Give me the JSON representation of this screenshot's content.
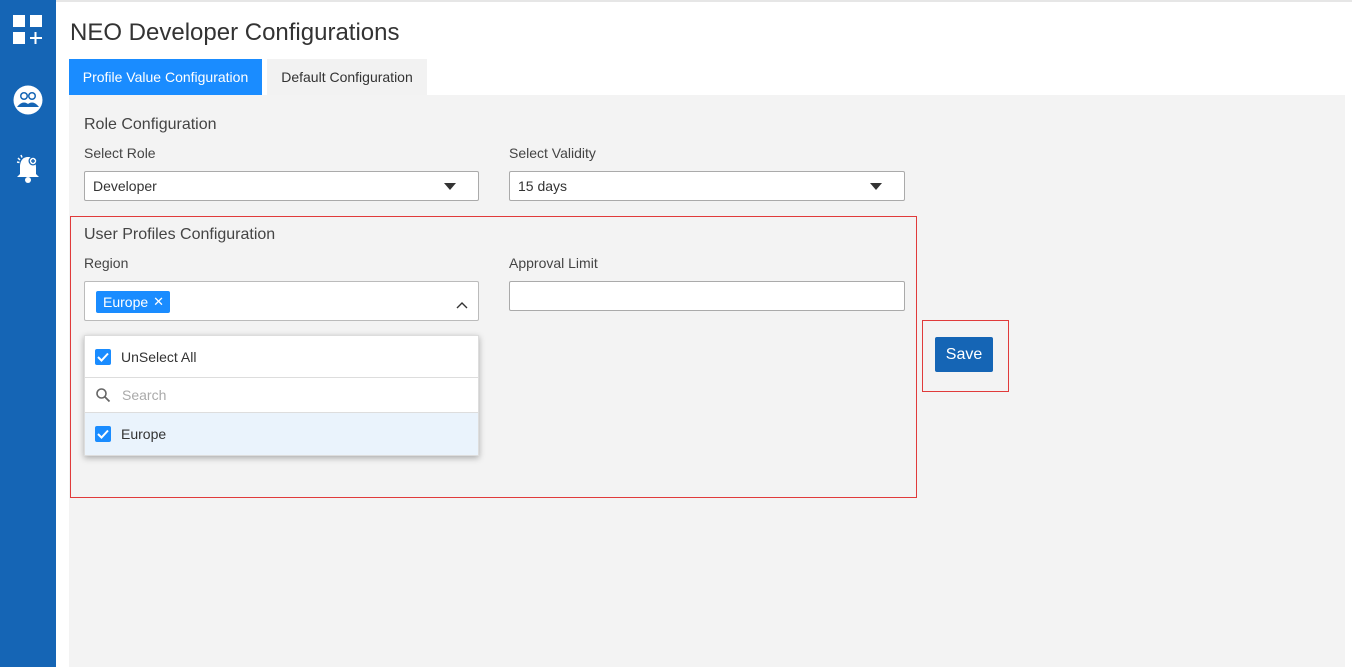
{
  "page": {
    "title": "NEO Developer Configurations"
  },
  "sidebar": {
    "items": [
      {
        "icon": "dashboard-add-icon"
      },
      {
        "icon": "users-group-icon"
      },
      {
        "icon": "notification-bell-icon"
      }
    ]
  },
  "tabs": [
    {
      "label": "Profile Value Configuration",
      "active": true
    },
    {
      "label": "Default Configuration",
      "active": false
    }
  ],
  "role_config": {
    "title": "Role Configuration",
    "role_label": "Select Role",
    "role_value": "Developer",
    "validity_label": "Select Validity",
    "validity_value": "15 days"
  },
  "user_profiles": {
    "title": "User Profiles Configuration",
    "region_label": "Region",
    "region_selected": [
      "Europe"
    ],
    "approval_label": "Approval Limit",
    "approval_value": ""
  },
  "region_dropdown": {
    "unselect_all_label": "UnSelect All",
    "search_placeholder": "Search",
    "options": [
      {
        "label": "Europe",
        "checked": true
      }
    ]
  },
  "actions": {
    "save_label": "Save"
  },
  "colors": {
    "sidebar": "#1565b5",
    "tab_active": "#1a8cff",
    "highlight": "#e03a3a",
    "panel": "#f3f3f3"
  }
}
